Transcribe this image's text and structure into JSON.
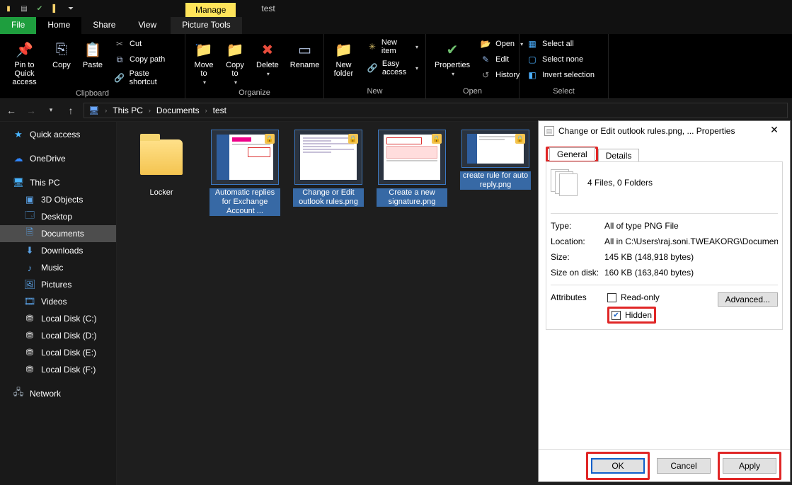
{
  "window": {
    "title": "test",
    "context_tab": "Manage"
  },
  "tabs": {
    "file": "File",
    "home": "Home",
    "share": "Share",
    "view": "View",
    "ptools": "Picture Tools"
  },
  "ribbon": {
    "clipboard": {
      "label": "Clipboard",
      "pin": "Pin to Quick access",
      "copy": "Copy",
      "paste": "Paste",
      "cut": "Cut",
      "copypath": "Copy path",
      "pasteshort": "Paste shortcut"
    },
    "organize": {
      "label": "Organize",
      "moveto": "Move to",
      "copyto": "Copy to",
      "delete": "Delete",
      "rename": "Rename"
    },
    "new": {
      "label": "New",
      "newfolder": "New folder",
      "newitem": "New item",
      "easy": "Easy access"
    },
    "open": {
      "label": "Open",
      "properties": "Properties",
      "open": "Open",
      "edit": "Edit",
      "history": "History"
    },
    "select": {
      "label": "Select",
      "selall": "Select all",
      "selnone": "Select none",
      "invert": "Invert selection"
    }
  },
  "breadcrumb": {
    "thispc": "This PC",
    "docs": "Documents",
    "test": "test"
  },
  "sidebar": {
    "quick": "Quick access",
    "onedrive": "OneDrive",
    "thispc": "This PC",
    "items": [
      "3D Objects",
      "Desktop",
      "Documents",
      "Downloads",
      "Music",
      "Pictures",
      "Videos",
      "Local Disk (C:)",
      "Local Disk (D:)",
      "Local Disk (E:)",
      "Local Disk (F:)"
    ],
    "network": "Network"
  },
  "files": [
    {
      "name": "Locker",
      "kind": "folder"
    },
    {
      "name": "Automatic replies for Exchange Account ...",
      "kind": "acct",
      "selected": true
    },
    {
      "name": "Change or Edit outlook rules.png",
      "kind": "doc",
      "selected": true
    },
    {
      "name": "Create a new signature.png",
      "kind": "sig",
      "selected": true
    },
    {
      "name": "create rule for auto reply.png",
      "kind": "rule",
      "selected": true
    }
  ],
  "props": {
    "title": "Change or Edit outlook rules.png, ... Properties",
    "tab_general": "General",
    "tab_details": "Details",
    "summary": "4 Files, 0 Folders",
    "rows": {
      "type_k": "Type:",
      "type_v": "All of type PNG File",
      "loc_k": "Location:",
      "loc_v": "All in C:\\Users\\raj.soni.TWEAKORG\\Documents\\tes",
      "size_k": "Size:",
      "size_v": "145 KB (148,918 bytes)",
      "disk_k": "Size on disk:",
      "disk_v": "160 KB (163,840 bytes)"
    },
    "attributes": "Attributes",
    "readonly": "Read-only",
    "hidden": "Hidden",
    "advanced": "Advanced...",
    "ok": "OK",
    "cancel": "Cancel",
    "apply": "Apply"
  }
}
